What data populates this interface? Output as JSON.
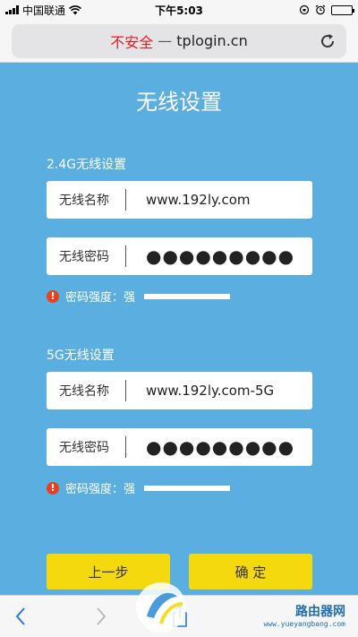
{
  "status_bar": {
    "carrier": "中国联通",
    "time": "下午5:03"
  },
  "browser": {
    "insecure_label": "不安全",
    "separator": "—",
    "host": "tplogin.cn"
  },
  "page": {
    "title": "无线设置",
    "band_24": {
      "section_label": "2.4G无线设置",
      "ssid_label": "无线名称",
      "ssid_value": "www.192ly.com",
      "password_label": "无线密码",
      "password_value": "●●●●●●●●●",
      "strength_label": "密码强度：",
      "strength_value": "强",
      "strength_level": 1.0
    },
    "band_5": {
      "section_label": "5G无线设置",
      "ssid_label": "无线名称",
      "ssid_value": "www.192ly.com-5G",
      "password_label": "无线密码",
      "password_value": "●●●●●●●●●",
      "strength_label": "密码强度：",
      "strength_value": "强",
      "strength_level": 1.0
    },
    "buttons": {
      "back": "上一步",
      "confirm": "确 定"
    }
  },
  "watermark": {
    "text": "路由器网",
    "url": "www.yueyangbang.com"
  },
  "colors": {
    "background": "#5aaee0",
    "button": "#f5d90f",
    "insecure": "#e02020",
    "warning": "#e8411f"
  }
}
